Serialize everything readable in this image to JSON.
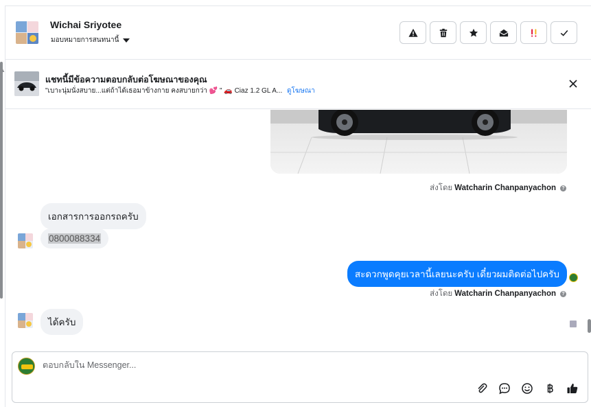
{
  "header": {
    "contact_name": "Wichai Sriyotee",
    "assign_label": "มอบหมายการสนทนานี้",
    "actions": [
      "warning-icon",
      "trash-icon",
      "star-icon",
      "envelope-open-icon",
      "spam-icon",
      "check-icon"
    ]
  },
  "ad_notice": {
    "title": "แชทนี้มีข้อความตอบกลับต่อโฆษณาของคุณ",
    "snippet": "\"เบาะนุ่มนั่งสบาย...แต่ถ้าได้เธอมาข้างกาย คงสบายกว่า 💕 \" 🚗 Ciaz 1.2 GL A...",
    "link": "ดูโฆษณา"
  },
  "messages": {
    "sent_by_prefix": "ส่งโดย",
    "sender_name": "Watcharin Chanpanyachon",
    "incoming_1": "เอกสารการออกรถครับ",
    "incoming_phone": "0800088334",
    "outgoing_1": "สะดวกพูดคุยเวลานี้เลยนะครับ เดี๋ยวผมติดต่อไปครับ",
    "incoming_2": "ได้ครับ"
  },
  "composer": {
    "placeholder": "ตอบกลับใน Messenger..."
  },
  "colors": {
    "accent": "#0a7cff",
    "link": "#1877f2",
    "spam": "#e41e3f"
  }
}
